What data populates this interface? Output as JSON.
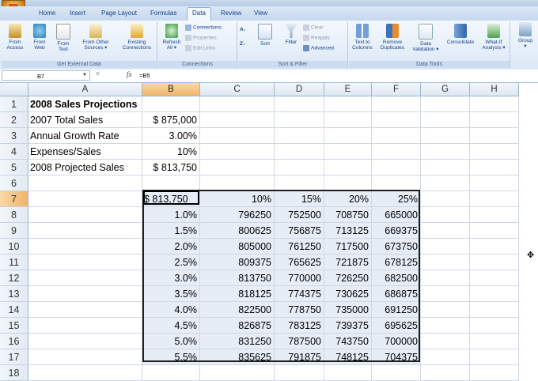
{
  "app": {
    "accent": "#15428b",
    "highlight": "#f0b46a"
  },
  "ribbon_tabs": [
    "Home",
    "Insert",
    "Page Layout",
    "Formulas",
    "Data",
    "Review",
    "View"
  ],
  "active_tab": "Data",
  "groups": {
    "external": {
      "label": "Get External Data",
      "buttons": [
        {
          "line1": "From",
          "line2": "Access",
          "icon": "access-icon"
        },
        {
          "line1": "From",
          "line2": "Web",
          "icon": "web-icon"
        },
        {
          "line1": "From",
          "line2": "Text",
          "icon": "text-file-icon"
        },
        {
          "line1": "From Other",
          "line2": "Sources ▾",
          "icon": "other-sources-icon"
        },
        {
          "line1": "Existing",
          "line2": "Connections",
          "icon": "existing-connections-icon"
        }
      ]
    },
    "connections": {
      "label": "Connections",
      "refresh": {
        "line1": "Refresh",
        "line2": "All ▾"
      },
      "small": [
        "Connections",
        "Properties",
        "Edit Links"
      ]
    },
    "sort": {
      "label": "Sort & Filter",
      "sort": "Sort",
      "filter": "Filter",
      "small": [
        "Clear",
        "Reapply",
        "Advanced"
      ]
    },
    "tools": {
      "label": "Data Tools",
      "buttons": [
        {
          "line1": "Text to",
          "line2": "Columns"
        },
        {
          "line1": "Remove",
          "line2": "Duplicates"
        },
        {
          "line1": "Data",
          "line2": "Validation ▾"
        },
        {
          "line1": "Consolidate",
          "line2": ""
        },
        {
          "line1": "What-If",
          "line2": "Analysis ▾"
        }
      ]
    },
    "outline": {
      "line1": "Group",
      "line2": "▾"
    }
  },
  "formula_bar": {
    "name_box": "B7",
    "fx": "fx",
    "formula": "=B5"
  },
  "columns": [
    "A",
    "B",
    "C",
    "D",
    "E",
    "F",
    "G",
    "H"
  ],
  "rows": [
    "1",
    "2",
    "3",
    "4",
    "5",
    "6",
    "7",
    "8",
    "9",
    "10",
    "11",
    "12",
    "13",
    "14",
    "15",
    "16",
    "17",
    "18"
  ],
  "labels": {
    "a1": "2008 Sales Projections",
    "a2": "2007 Total Sales",
    "b2": "$ 875,000",
    "a3": "Annual Growth Rate",
    "b3": "3.00%",
    "a4": "Expenses/Sales",
    "b4": "10%",
    "a5": "2008 Projected Sales",
    "b5": "$ 813,750"
  },
  "table": {
    "corner": "$ 813,750",
    "col_headers": [
      "10%",
      "15%",
      "20%",
      "25%"
    ],
    "rows": [
      {
        "rate": "1.0%",
        "v": [
          "796250",
          "752500",
          "708750",
          "665000"
        ]
      },
      {
        "rate": "1.5%",
        "v": [
          "800625",
          "756875",
          "713125",
          "669375"
        ]
      },
      {
        "rate": "2.0%",
        "v": [
          "805000",
          "761250",
          "717500",
          "673750"
        ]
      },
      {
        "rate": "2.5%",
        "v": [
          "809375",
          "765625",
          "721875",
          "678125"
        ]
      },
      {
        "rate": "3.0%",
        "v": [
          "813750",
          "770000",
          "726250",
          "682500"
        ]
      },
      {
        "rate": "3.5%",
        "v": [
          "818125",
          "774375",
          "730625",
          "686875"
        ]
      },
      {
        "rate": "4.0%",
        "v": [
          "822500",
          "778750",
          "735000",
          "691250"
        ]
      },
      {
        "rate": "4.5%",
        "v": [
          "826875",
          "783125",
          "739375",
          "695625"
        ]
      },
      {
        "rate": "5.0%",
        "v": [
          "831250",
          "787500",
          "743750",
          "700000"
        ]
      },
      {
        "rate": "5.5%",
        "v": [
          "835625",
          "791875",
          "748125",
          "704375"
        ]
      }
    ]
  }
}
